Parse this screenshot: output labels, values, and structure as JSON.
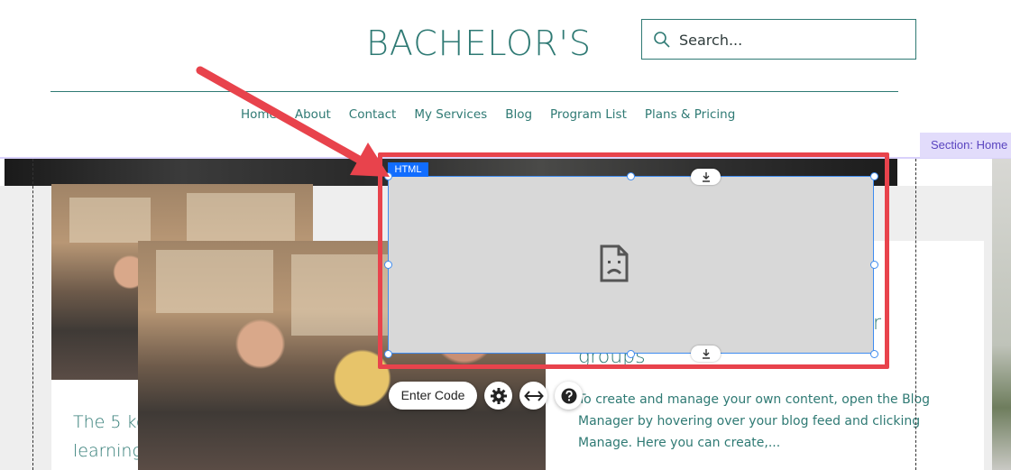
{
  "header": {
    "site_title": "BACHELOR'S",
    "search": {
      "placeholder": "Search...",
      "icon": "search-icon"
    },
    "nav": [
      "Home",
      "About",
      "Contact",
      "My Services",
      "Blog",
      "Program List",
      "Plans & Pricing"
    ]
  },
  "editor": {
    "section_label": "Section: Home",
    "element_label": "HTML",
    "element_state_icon": "broken-page-icon",
    "toolbar": {
      "enter_code_label": "Enter Code",
      "settings_icon": "gear-icon",
      "stretch_icon": "stretch-horizontal-icon",
      "help_icon": "help-icon"
    },
    "anchor_icon": "download-anchor-icon"
  },
  "content": {
    "left_card_title_line1": "The 5 ke",
    "left_card_title_line2": "learning",
    "right_card_title_fragment": "groups",
    "right_card_title_letter": "r",
    "right_card_body": "To create and manage your own content, open the Blog Manager by hovering over your blog feed and clicking Manage. Here you can create,..."
  },
  "colors": {
    "brand_teal": "#2f7a74",
    "selection_blue": "#116dff",
    "annotation_red": "#e8434c",
    "section_tag_bg": "#e2dcfb"
  }
}
